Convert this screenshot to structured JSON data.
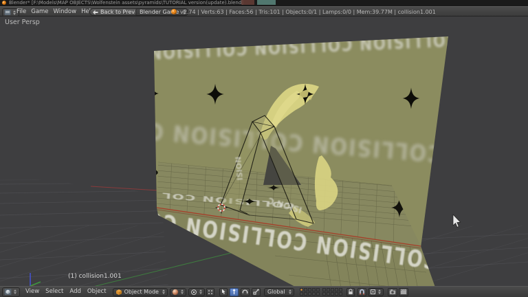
{
  "title_bar": {
    "title": "Blender* [F:\\Models\\MAP OBJECTS\\Wolfenstein assets\\pyramids\\TUTORIAL version(update).blend]"
  },
  "info_bar": {
    "menus": [
      "File",
      "Game",
      "Window",
      "Help"
    ],
    "back_button": "Back to Previous",
    "engine_select": "Blender Game",
    "stats": "v2.74 | Verts:63 | Faces:56 | Tris:101 | Objects:0/1 | Lamps:0/0 | Mem:39.77M | collision1.001"
  },
  "scene": {
    "view_label": "User Persp",
    "object_info": "(1) collision1.001",
    "tex_row_top": "COLLISION COLLISION COLLISION",
    "tex_row_mid": "COLLISION COLLISION C",
    "tex_row_band": "COLLISION COLLISION CO",
    "tex_row_ground": "COLLISION COL",
    "tex_frag_left": "ISION",
    "tex_frag_right": "ISION C"
  },
  "header3d": {
    "menus": [
      "View",
      "Select",
      "Add",
      "Object"
    ],
    "mode_select": "Object Mode",
    "orientation_select": "Global"
  },
  "colors": {
    "wall": "#8b8c5f",
    "ground": "#878860",
    "band": "#83845b",
    "flame": "#d8d382",
    "texture_text": "#d3d3c6",
    "red_edge": "#a83c28",
    "viewport_bg": "#3e3e40",
    "accent_orange": "#e8891e"
  }
}
